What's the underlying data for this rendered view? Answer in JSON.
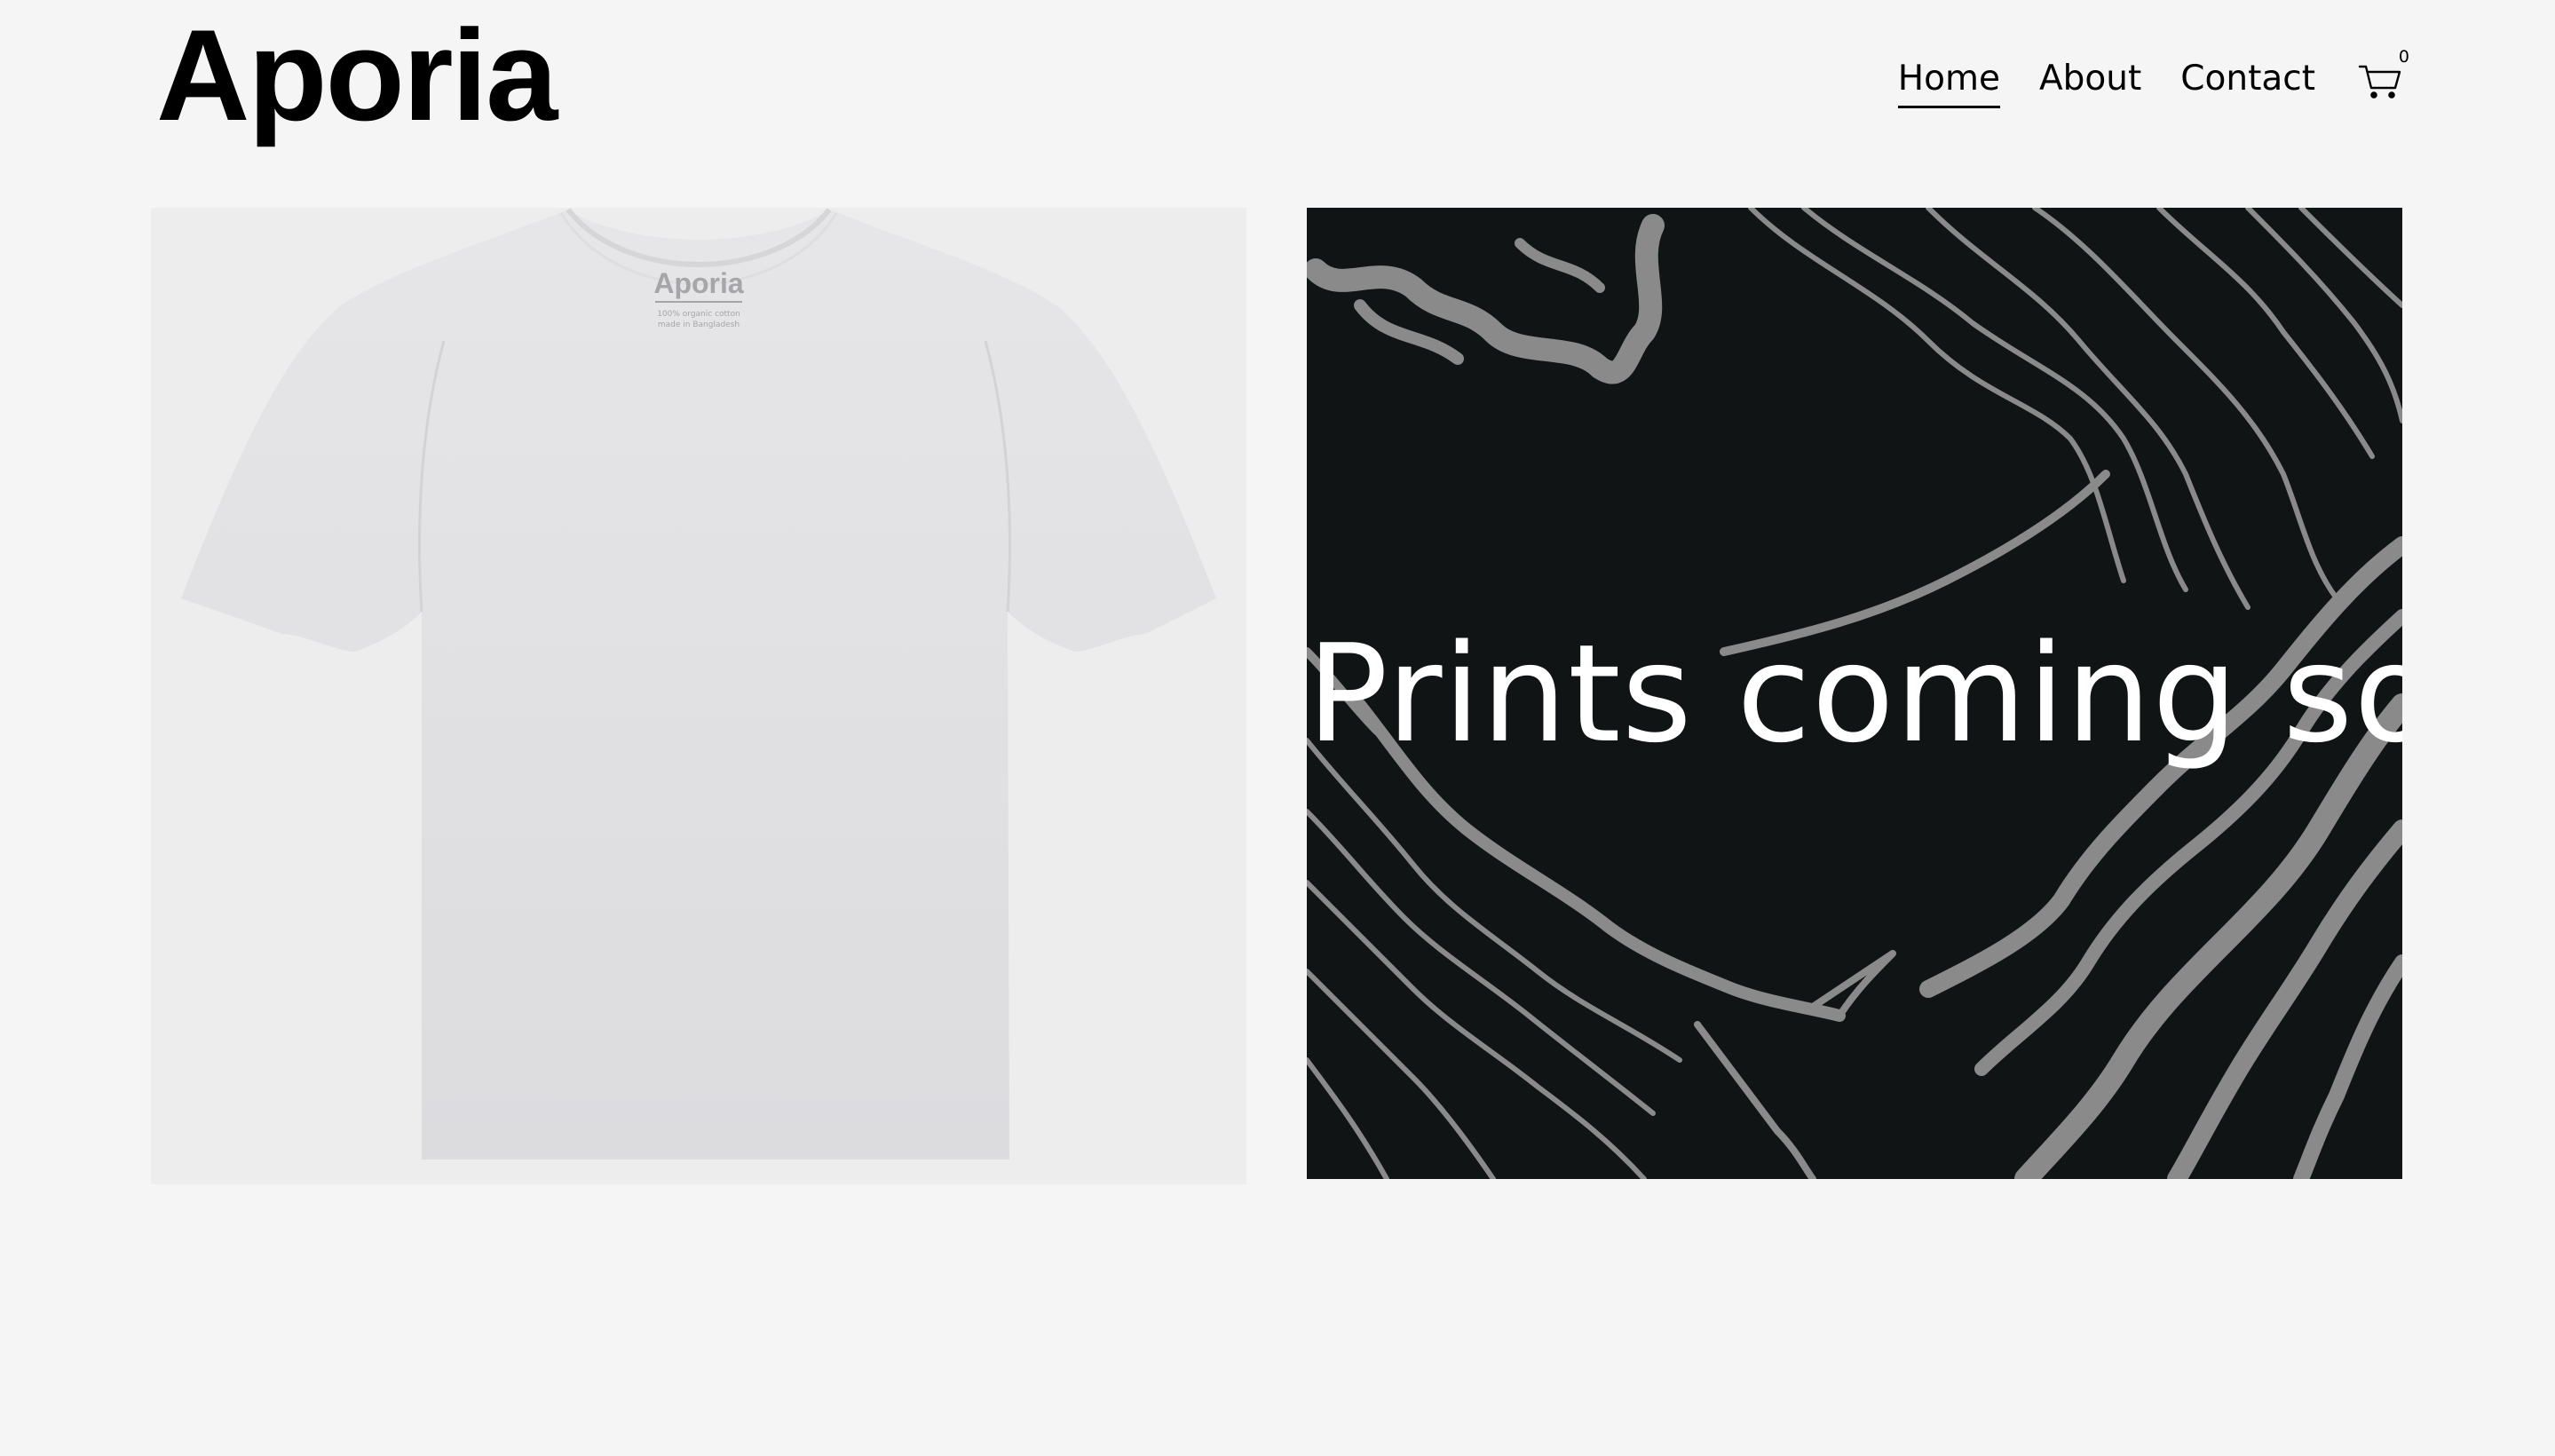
{
  "site": {
    "logo": "Aporia"
  },
  "nav": {
    "items": [
      {
        "label": "Home",
        "active": true
      },
      {
        "label": "About",
        "active": false
      },
      {
        "label": "Contact",
        "active": false
      }
    ],
    "cart_count": "0",
    "cart_icon": "cart-icon"
  },
  "products": {
    "tshirt": {
      "brand_label": "Aporia",
      "label_line1": "100% organic cotton",
      "label_line2": "made in Bangladesh",
      "shirt_color": "#e1e1e3"
    },
    "prints": {
      "caption": "Prints coming soon",
      "background_color": "#101415",
      "pattern_color": "#8a8a8a"
    }
  },
  "colors": {
    "page_background": "#f5f5f5",
    "text": "#000000"
  }
}
